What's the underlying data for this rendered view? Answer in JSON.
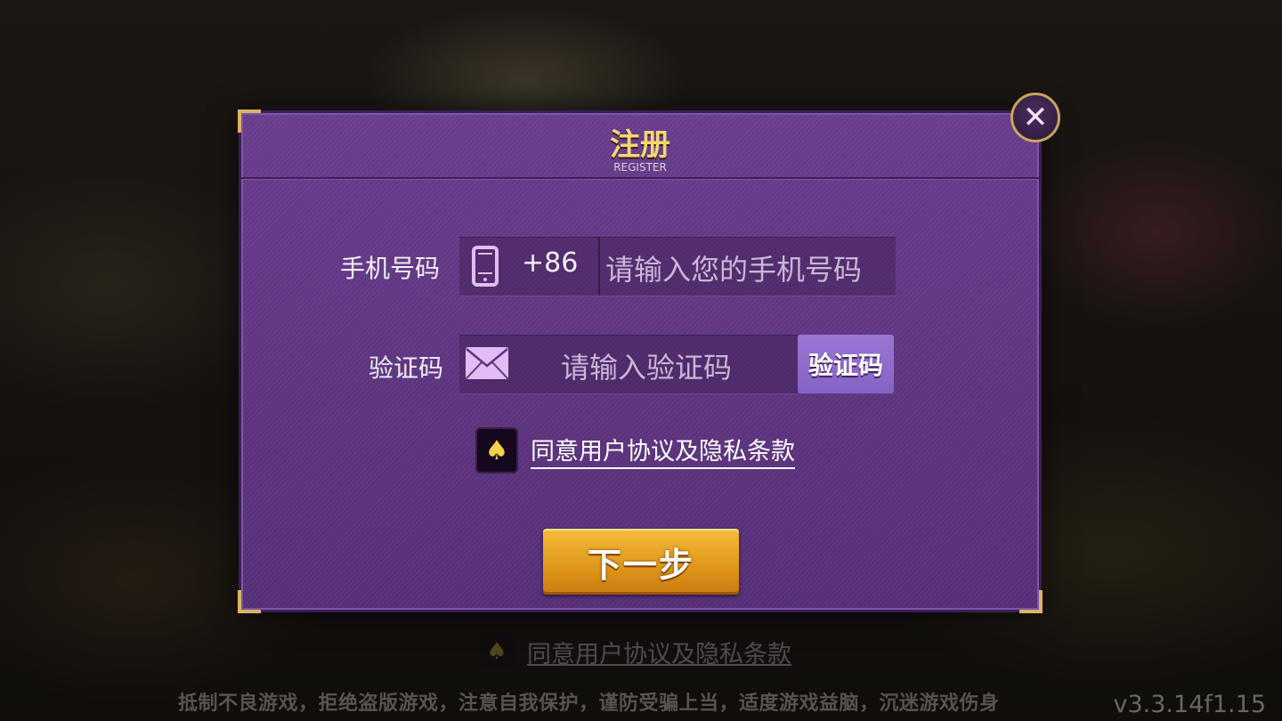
{
  "dialog": {
    "title": "注册",
    "subtitle": "REGISTER",
    "close_icon": "close-icon",
    "phone": {
      "label": "手机号码",
      "prefix": "+86",
      "placeholder": "请输入您的手机号码",
      "icon": "phone-icon"
    },
    "code": {
      "label": "验证码",
      "placeholder": "请输入验证码",
      "button_label": "验证码",
      "icon": "mail-icon"
    },
    "agreement": {
      "text": "同意用户协议及隐私条款",
      "icon": "spade-icon",
      "checked": true
    },
    "next_label": "下一步"
  },
  "background": {
    "agreement_text": "同意用户协议及隐私条款",
    "warning": "抵制不良游戏，拒绝盗版游戏，注意自我保护，谨防受骗上当，适度游戏益脑，沉迷游戏伤身",
    "version": "v3.3.14f1.15"
  },
  "colors": {
    "dialog_purple": "#5e3580",
    "gold_accent": "#d9b464",
    "title_gold": "#f4d674",
    "next_button": "#e09a1a",
    "code_button": "#8f6bcc"
  }
}
